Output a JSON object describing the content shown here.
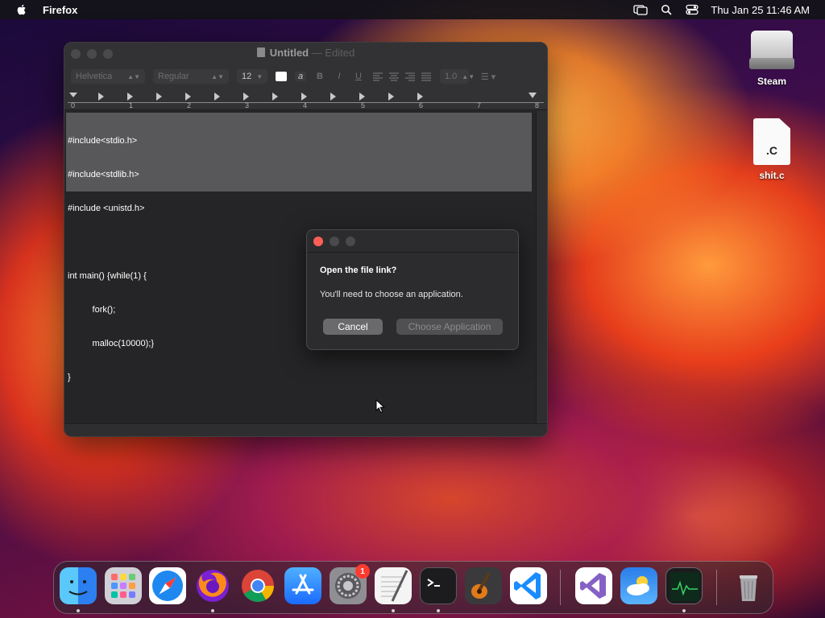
{
  "menubar": {
    "app_name": "Firefox",
    "clock": "Thu Jan 25  11:46 AM"
  },
  "desktop": {
    "icons": [
      {
        "label": "Steam"
      },
      {
        "label": "shit.c",
        "ext": ".C"
      }
    ]
  },
  "textedit": {
    "title": "Untitled",
    "title_sep": "—",
    "title_state": "Edited",
    "font_family": "Helvetica",
    "font_style": "Regular",
    "font_size": "12",
    "line_spacing": "1.0",
    "format_buttons": [
      "B",
      "I",
      "U"
    ],
    "ruler_numbers": [
      "0",
      "1",
      "2",
      "3",
      "4",
      "5",
      "6",
      "7",
      "8"
    ],
    "code_lines": [
      "#include<stdio.h>",
      "#include<stdlib.h>",
      "#include <unistd.h>",
      "",
      "int main() {while(1) {",
      "          fork();",
      "          malloc(10000);}",
      "}"
    ]
  },
  "dialog": {
    "title": "Open the file link?",
    "message": "You'll need to choose an application.",
    "cancel_label": "Cancel",
    "choose_label": "Choose Application"
  },
  "dock": {
    "items": [
      {
        "name": "finder",
        "color": "#3aa0f0"
      },
      {
        "name": "launchpad",
        "color": "#d8d8dc"
      },
      {
        "name": "safari",
        "color": "#1e7cf0"
      },
      {
        "name": "firefox",
        "color": "#ff7a1a"
      },
      {
        "name": "chrome",
        "color": "#ffffff"
      },
      {
        "name": "app-store",
        "color": "#1a8cff"
      },
      {
        "name": "system-settings",
        "color": "#8e8e93",
        "badge": "1"
      },
      {
        "name": "textedit",
        "color": "#f4f4f4"
      },
      {
        "name": "terminal",
        "color": "#1c1c1e"
      },
      {
        "name": "garageband",
        "color": "#3a3a3c"
      },
      {
        "name": "vscode",
        "color": "#ffffff"
      },
      {
        "name": "visual-studio",
        "color": "#ffffff"
      },
      {
        "name": "weather",
        "color": "#2f8ef0"
      },
      {
        "name": "activity-monitor",
        "color": "#2a2a2c"
      },
      {
        "name": "trash",
        "color": "#b0b0b4"
      }
    ]
  }
}
